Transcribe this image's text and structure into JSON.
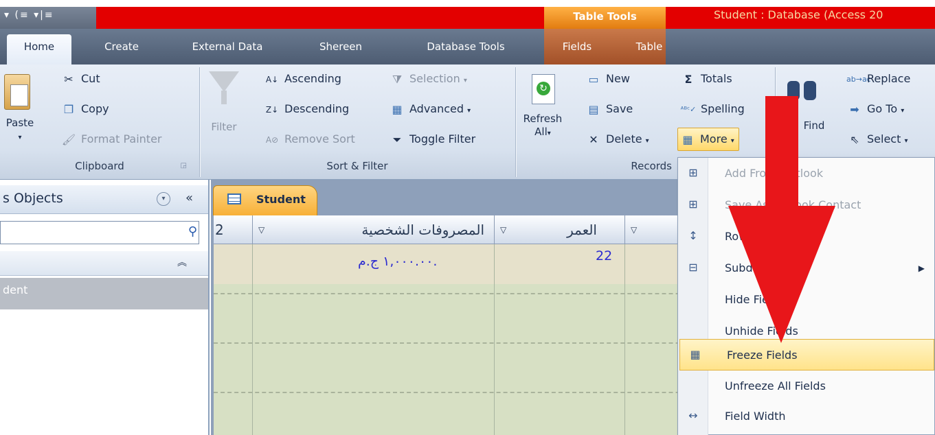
{
  "titlebar": {
    "qat_symbols": "▾ (≡ ▾|≡",
    "context_title": "Table Tools",
    "app_title": "Student : Database (Access 20"
  },
  "tabs": {
    "home": "Home",
    "create": "Create",
    "external": "External Data",
    "shereen": "Shereen",
    "dbtools": "Database Tools",
    "fields": "Fields",
    "table": "Table"
  },
  "clipboard": {
    "paste": "Paste",
    "cut": "Cut",
    "copy": "Copy",
    "format_painter": "Format Painter",
    "label": "Clipboard"
  },
  "sortfilter": {
    "filter": "Filter",
    "ascending": "Ascending",
    "descending": "Descending",
    "remove_sort": "Remove Sort",
    "selection": "Selection",
    "advanced": "Advanced",
    "toggle_filter": "Toggle Filter",
    "label": "Sort & Filter"
  },
  "records": {
    "refresh": "Refresh",
    "refresh_all": "All",
    "new": "New",
    "save": "Save",
    "delete": "Delete",
    "totals": "Totals",
    "spelling": "Spelling",
    "more": "More",
    "label": "Records"
  },
  "find": {
    "find": "Find",
    "replace": "Replace",
    "goto": "Go To",
    "select": "Select"
  },
  "navpane": {
    "title": "s Objects",
    "item": "dent"
  },
  "document": {
    "tab_label": "Student",
    "col_partial": "2",
    "col_expenses": "المصروفات الشخصية",
    "col_age": "العمر",
    "row1_expenses": "١,٠٠٠.٠٠ ج.م.",
    "row1_age": "22"
  },
  "menu": {
    "add_from_outlook": "Add From Outlook",
    "save_as_outlook": "Save As Outlook Contact",
    "row_height": "Row Height...",
    "subdatasheet": "Subdatasheet",
    "hide_fields": "Hide Fields",
    "unhide_fields": "Unhide Fields",
    "freeze_fields": "Freeze Fields",
    "unfreeze_all": "Unfreeze All Fields",
    "field_width": "Field Width"
  },
  "colors": {
    "title_red": "#e30000",
    "context_orange": "#f0901f",
    "arrow_red": "#e8161a",
    "highlight": "#ffe38a"
  }
}
